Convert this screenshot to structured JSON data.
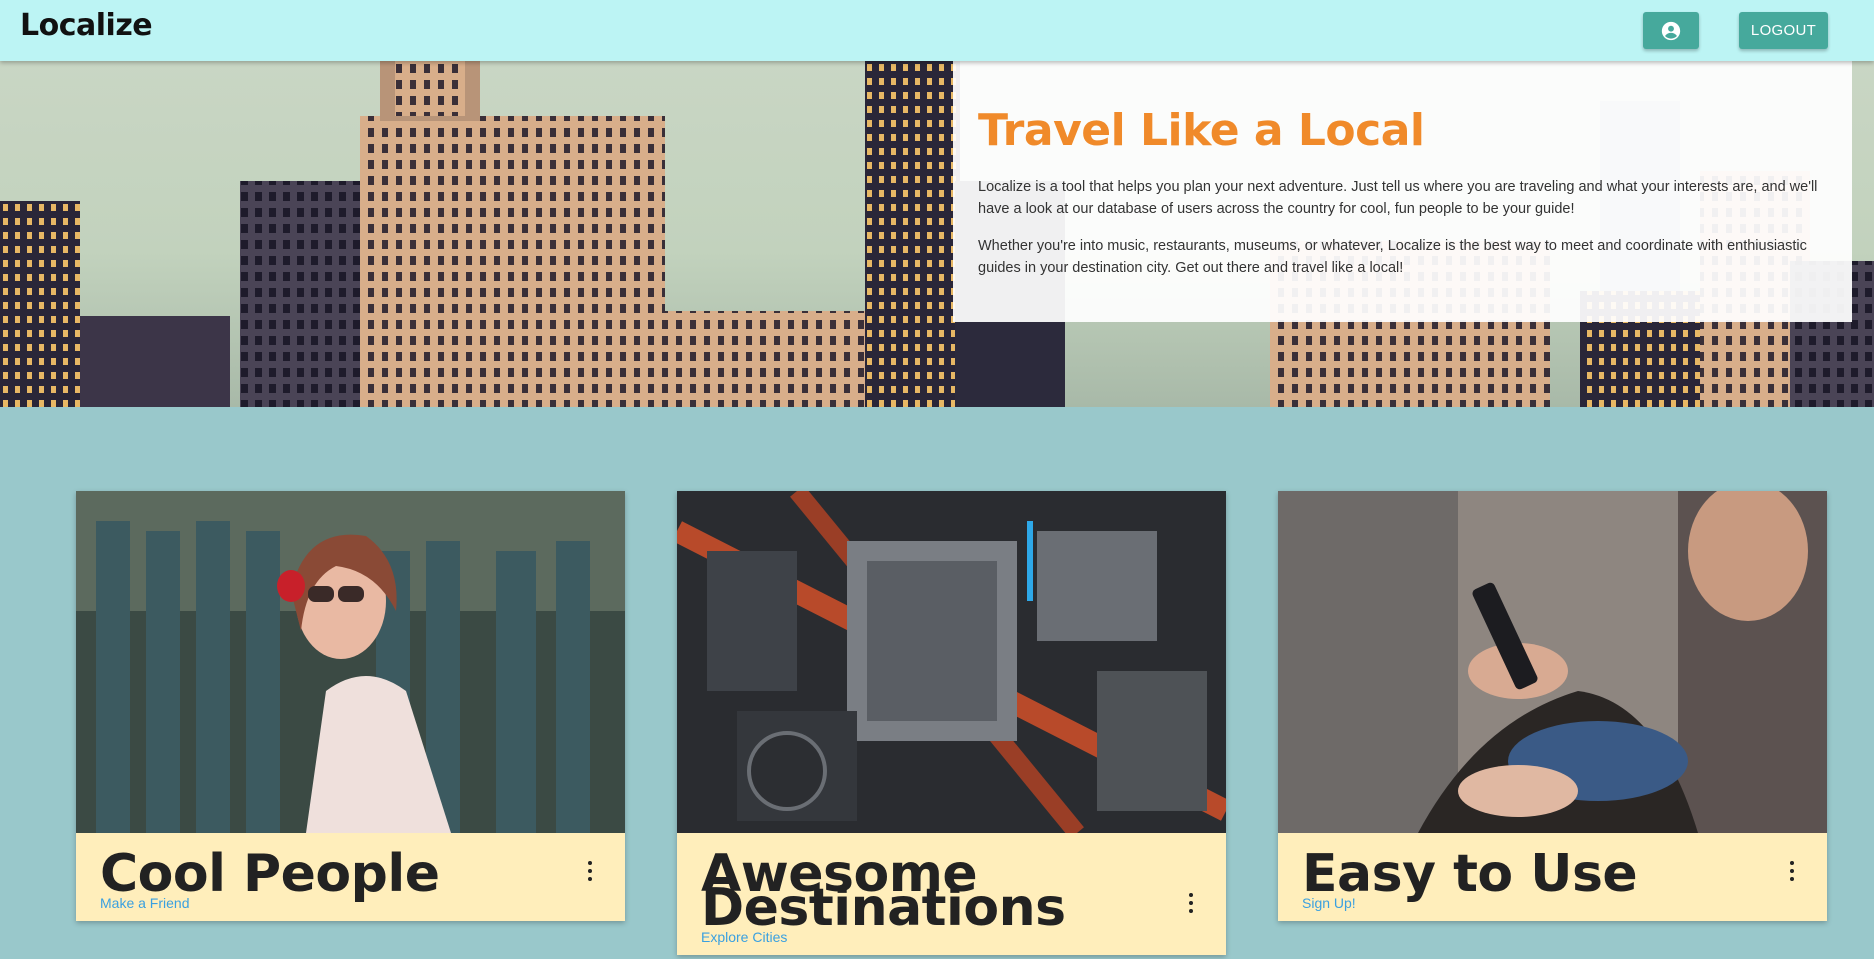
{
  "app": {
    "brand": "Localize",
    "account_icon": "account-circle-icon",
    "logout_label": "LOGOUT"
  },
  "intro": {
    "title": "Travel Like a Local",
    "paragraph1": "Localize is a tool that helps you plan your next adventure. Just tell us where you are traveling and what your interests are, and we'll have a look at our database of users across the country for cool, fun people to be your guide!",
    "paragraph2": "Whether you're into music, restaurants, museums, or whatever, Localize is the best way to meet and coordinate with enthiusiastic guides in your destination city. Get out there and travel like a local!"
  },
  "cards": [
    {
      "title": "Cool People",
      "link": "Make a Friend",
      "menu_icon": "more-vert-icon"
    },
    {
      "title": "Awesome Destinations",
      "link": "Explore Cities",
      "menu_icon": "more-vert-icon"
    },
    {
      "title": "Easy to Use",
      "link": "Sign Up!",
      "menu_icon": "more-vert-icon"
    }
  ],
  "colors": {
    "header_bg": "#bcf4f4",
    "page_bg": "#99c8cb",
    "button_bg": "#46a99c",
    "accent_orange": "#f08a2a",
    "card_bg": "#ffeebb",
    "link_blue": "#3aa0e0"
  }
}
